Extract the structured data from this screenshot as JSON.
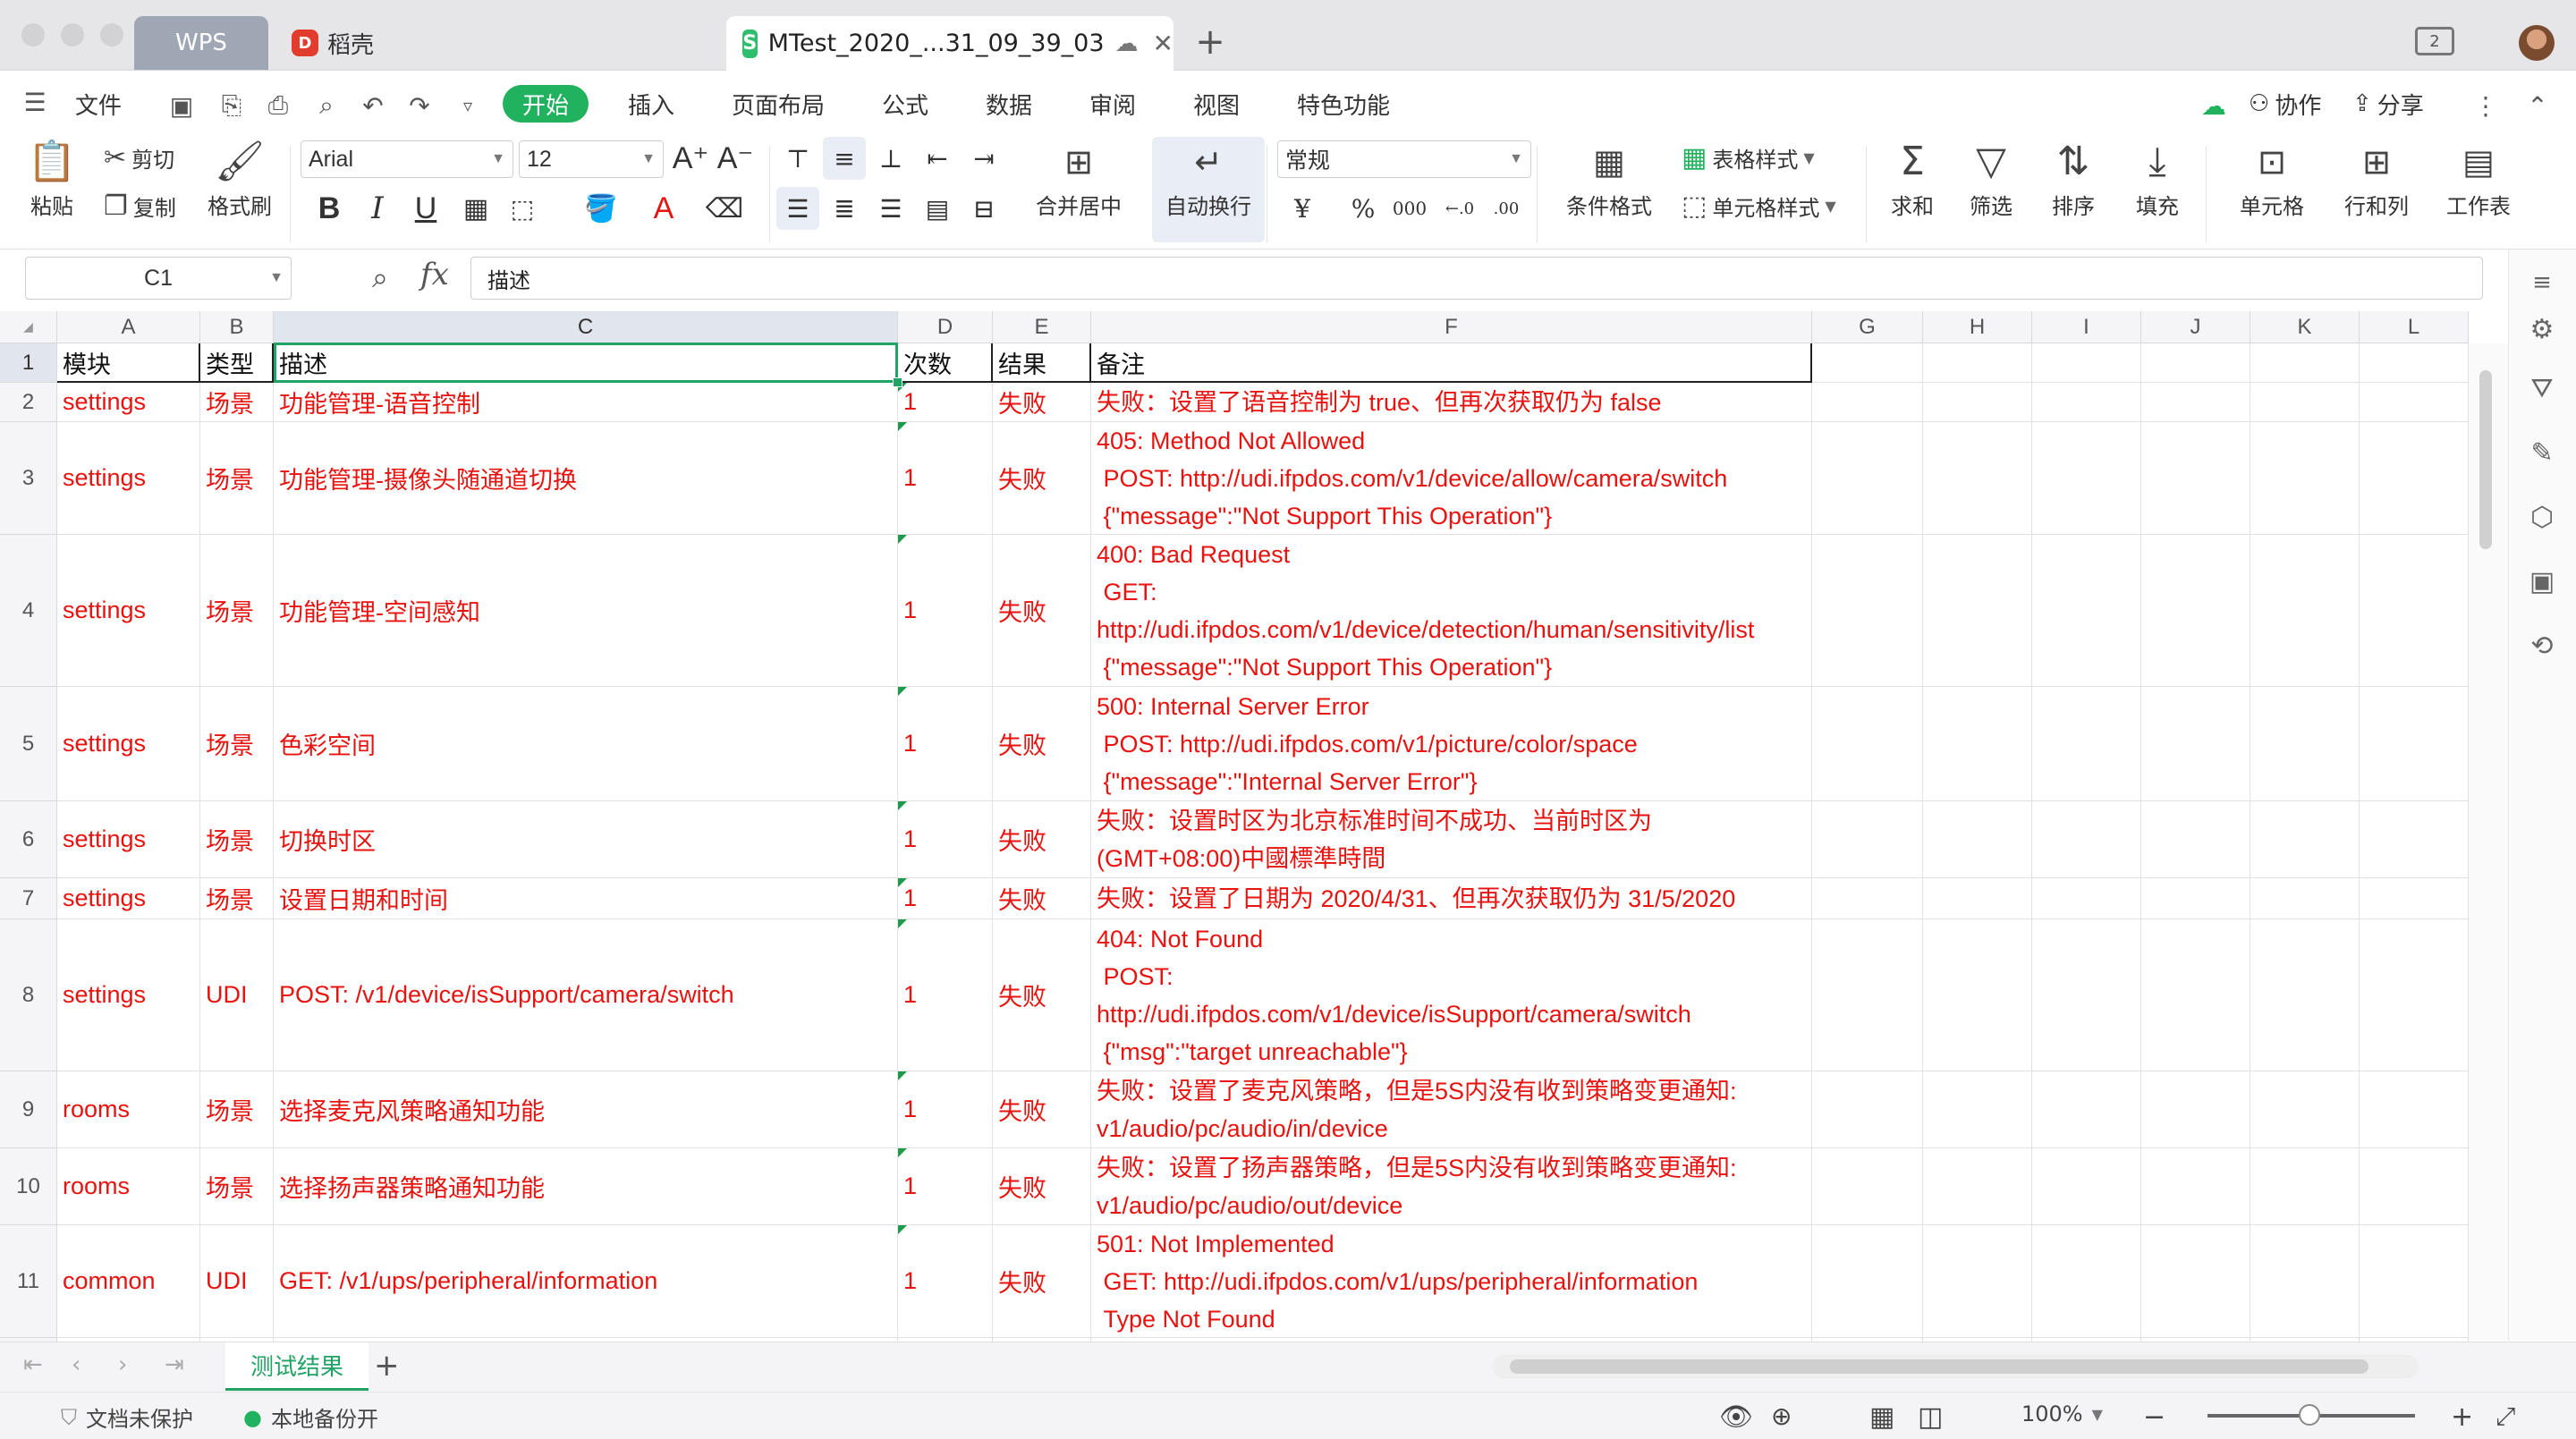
{
  "titlebar": {
    "tab_wps": "WPS",
    "tab_daoke": "稻壳",
    "tab_doc": "MTest_2020_...31_09_39_03",
    "new_tab": "+"
  },
  "menu": {
    "file": "文件",
    "start": "开始",
    "insert": "插入",
    "page_layout": "页面布局",
    "formula": "公式",
    "data": "数据",
    "review": "审阅",
    "view": "视图",
    "special": "特色功能",
    "collab": "协作",
    "share": "分享"
  },
  "ribbon": {
    "paste": "粘贴",
    "cut": "剪切",
    "copy": "复制",
    "format_painter": "格式刷",
    "font_name": "Arial",
    "font_size": "12",
    "merge_center": "合并居中",
    "wrap_text": "自动换行",
    "number_format": "常规",
    "cond_format": "条件格式",
    "table_style": "表格样式",
    "cell_style": "单元格样式",
    "sum": "求和",
    "filter": "筛选",
    "sort": "排序",
    "fill": "填充",
    "cell": "单元格",
    "row_col": "行和列",
    "worksheet": "工作表"
  },
  "formula_bar": {
    "cell_ref": "C1",
    "content": "描述"
  },
  "grid": {
    "columns": [
      "A",
      "B",
      "C",
      "D",
      "E",
      "F",
      "G",
      "H",
      "I",
      "J",
      "K",
      "L"
    ],
    "header": [
      "模块",
      "类型",
      "描述",
      "次数",
      "结果",
      "备注"
    ],
    "rows": [
      {
        "num": "2",
        "a": "settings",
        "b": "场景",
        "c": "功能管理-语音控制",
        "d": "1",
        "e": "失败",
        "f": "失败：设置了语音控制为 true、但再次获取仍为 false"
      },
      {
        "num": "3",
        "a": "settings",
        "b": "场景",
        "c": "功能管理-摄像头随通道切换",
        "d": "1",
        "e": "失败",
        "f": "405: Method Not Allowed\n POST: http://udi.ifpdos.com/v1/device/allow/camera/switch\n {\"message\":\"Not Support This Operation\"}"
      },
      {
        "num": "4",
        "a": "settings",
        "b": "场景",
        "c": "功能管理-空间感知",
        "d": "1",
        "e": "失败",
        "f": "400: Bad Request\n GET:\nhttp://udi.ifpdos.com/v1/device/detection/human/sensitivity/list\n {\"message\":\"Not Support This Operation\"}"
      },
      {
        "num": "5",
        "a": "settings",
        "b": "场景",
        "c": "色彩空间",
        "d": "1",
        "e": "失败",
        "f": "500: Internal Server Error\n POST: http://udi.ifpdos.com/v1/picture/color/space\n {\"message\":\"Internal Server Error\"}"
      },
      {
        "num": "6",
        "a": "settings",
        "b": "场景",
        "c": "切换时区",
        "d": "1",
        "e": "失败",
        "f": "失败：设置时区为北京标准时间不成功、当前时区为\n(GMT+08:00)中國標準時間"
      },
      {
        "num": "7",
        "a": "settings",
        "b": "场景",
        "c": "设置日期和时间",
        "d": "1",
        "e": "失败",
        "f": "失败：设置了日期为 2020/4/31、但再次获取仍为 31/5/2020"
      },
      {
        "num": "8",
        "a": "settings",
        "b": "UDI",
        "c": "POST: /v1/device/isSupport/camera/switch",
        "d": "1",
        "e": "失败",
        "f": "404: Not Found\n POST:\nhttp://udi.ifpdos.com/v1/device/isSupport/camera/switch\n {\"msg\":\"target unreachable\"}"
      },
      {
        "num": "9",
        "a": "rooms",
        "b": "场景",
        "c": "选择麦克风策略通知功能",
        "d": "1",
        "e": "失败",
        "f": "失败：设置了麦克风策略，但是5S内没有收到策略变更通知:\nv1/audio/pc/audio/in/device"
      },
      {
        "num": "10",
        "a": "rooms",
        "b": "场景",
        "c": "选择扬声器策略通知功能",
        "d": "1",
        "e": "失败",
        "f": "失败：设置了扬声器策略，但是5S内没有收到策略变更通知:\nv1/audio/pc/audio/out/device"
      },
      {
        "num": "11",
        "a": "common",
        "b": "UDI",
        "c": "GET: /v1/ups/peripheral/information",
        "d": "1",
        "e": "失败",
        "f": "501: Not Implemented\n GET: http://udi.ifpdos.com/v1/ups/peripheral/information\n Type Not Found"
      }
    ]
  },
  "sheets": {
    "active": "测试结果",
    "add": "+"
  },
  "status": {
    "protect": "文档未保护",
    "backup": "本地备份开",
    "zoom": "100%"
  },
  "colors": {
    "accent": "#20b25e",
    "cell_text": "#e8120f"
  }
}
